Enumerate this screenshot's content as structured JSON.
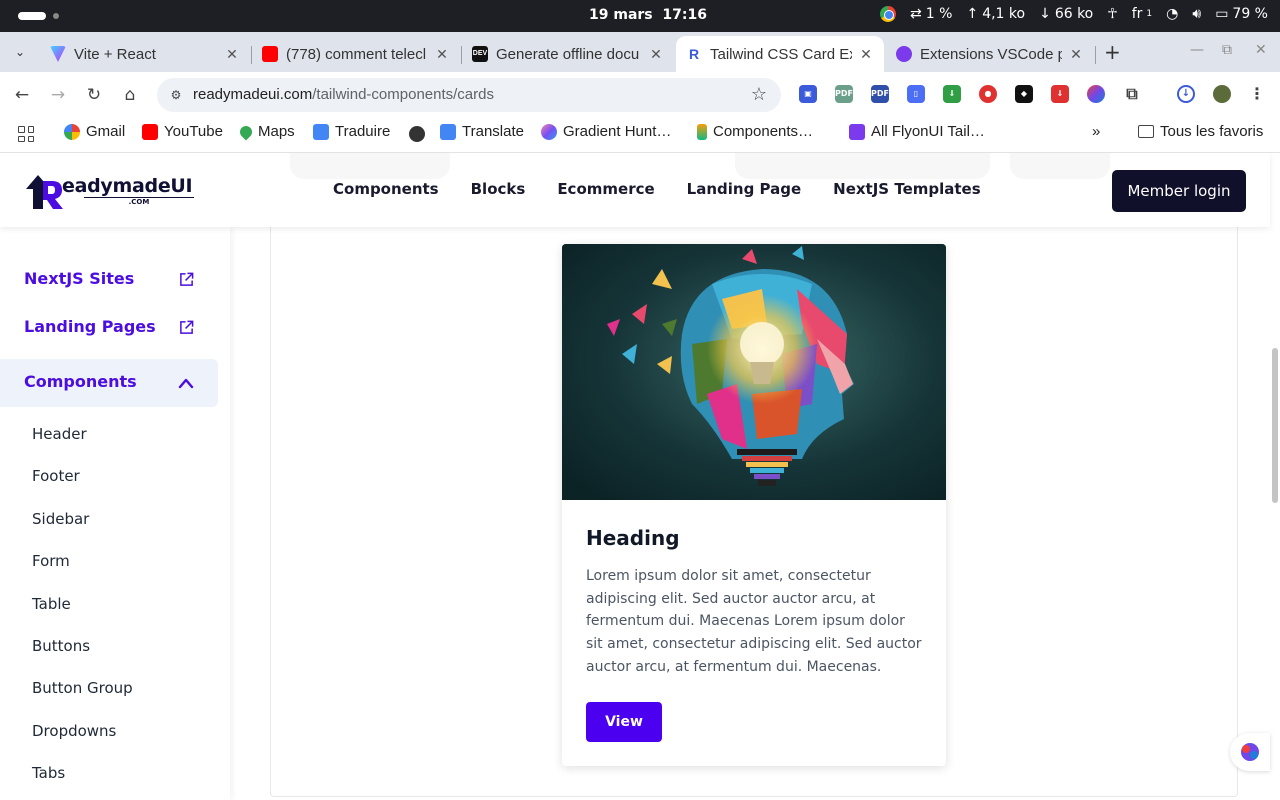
{
  "os": {
    "date": "19 mars",
    "time": "17:16",
    "cpu": "1 %",
    "upload": "4,1 ko",
    "download": "66 ko",
    "lang": "fr",
    "lang_sub": "1",
    "battery": "79 %"
  },
  "tabs": [
    {
      "title": "Vite + React",
      "color": "#8b5cf6"
    },
    {
      "title": "(778) comment telecl",
      "color": "#ff0000"
    },
    {
      "title": "Generate offline docu",
      "color": "#111111"
    },
    {
      "title": "Tailwind CSS Card Ex",
      "color": "#3b5bdb"
    },
    {
      "title": "Extensions VSCode p",
      "color": "#7c3aed"
    }
  ],
  "toolbar": {
    "url_host": "readymadeui.com",
    "url_path": "/tailwind-components/cards"
  },
  "bookmarks": [
    {
      "label": "Gmail",
      "color": "#ea4335"
    },
    {
      "label": "YouTube",
      "color": "#ff0000"
    },
    {
      "label": "Maps",
      "color": "#34a853"
    },
    {
      "label": "Traduire",
      "color": "#4285f4"
    },
    {
      "label": "",
      "color": "#333333"
    },
    {
      "label": "Translate",
      "color": "#4285f4"
    },
    {
      "label": "Gradient Hunt…",
      "color": "#8b5cf6"
    },
    {
      "label": "Components…",
      "color": "#f59e0b"
    },
    {
      "label": "All FlyonUI Tail…",
      "color": "#7c3aed"
    }
  ],
  "bookmarks_all": "Tous les favoris",
  "site": {
    "logo_text": "eadymadeUI",
    "logo_sub": ".COM",
    "nav": [
      "Components",
      "Blocks",
      "Ecommerce",
      "Landing Page",
      "NextJS Templates"
    ],
    "member_login": "Member login"
  },
  "sidebar": {
    "links": [
      "NextJS Sites",
      "Landing Pages"
    ],
    "group": "Components",
    "items": [
      "Header",
      "Footer",
      "Sidebar",
      "Form",
      "Table",
      "Buttons",
      "Button Group",
      "Dropdowns",
      "Tabs"
    ]
  },
  "card": {
    "heading": "Heading",
    "body": "Lorem ipsum dolor sit amet, consectetur adipiscing elit. Sed auctor auctor arcu, at fermentum dui. Maecenas Lorem ipsum dolor sit amet, consectetur adipiscing elit. Sed auctor auctor arcu, at fermentum dui. Maecenas.",
    "button": "View"
  },
  "colors": {
    "brand_purple": "#4c0ee0",
    "button_purple": "#4c00f0",
    "dark_navy": "#10102a"
  }
}
